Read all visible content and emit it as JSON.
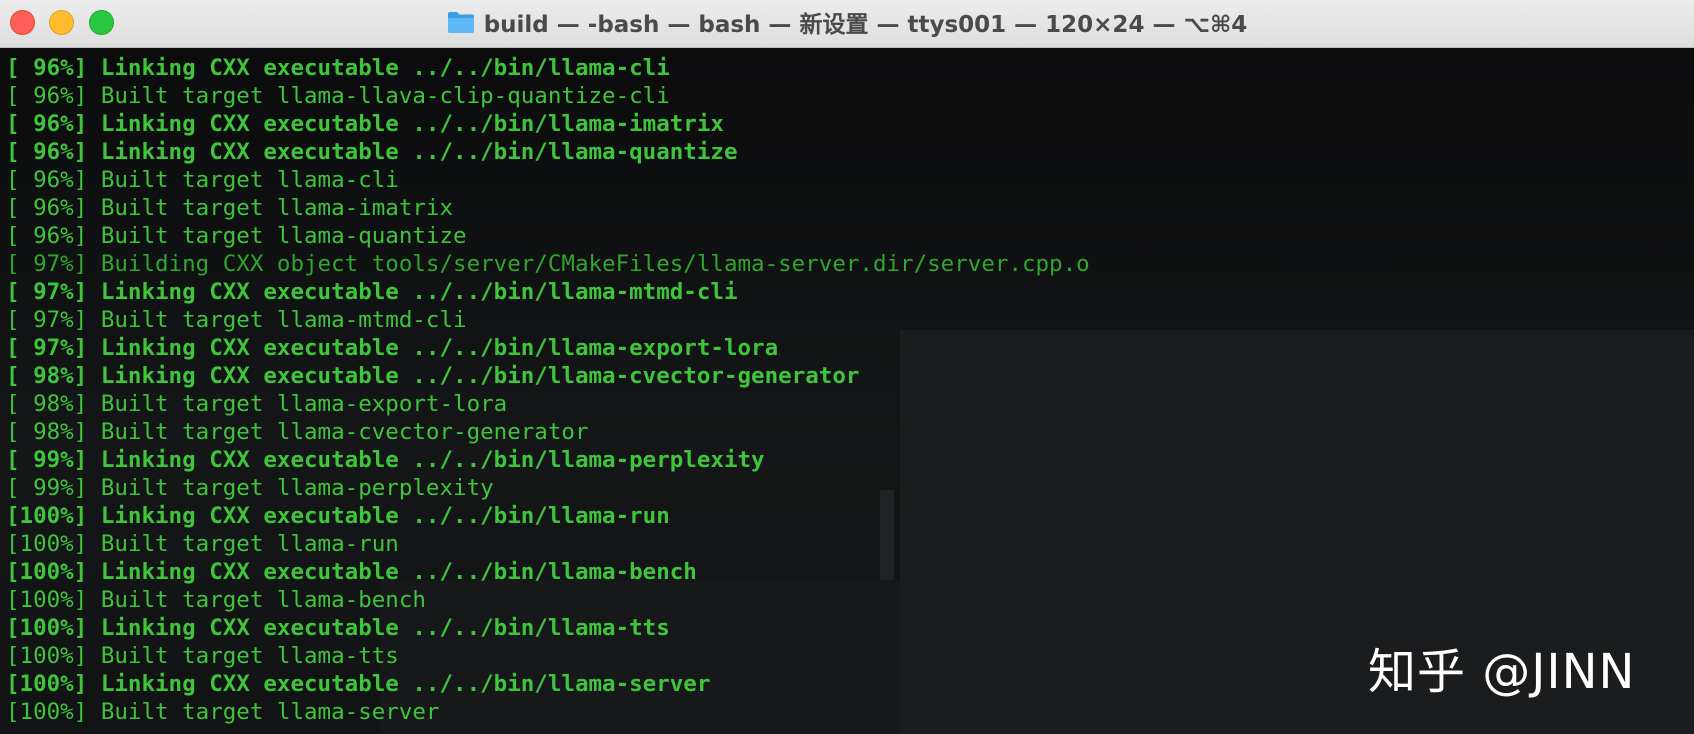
{
  "window": {
    "title": "build — -bash — bash — 新设置 — ttys001 — 120×24 — ⌥⌘4"
  },
  "terminal": {
    "lines": [
      {
        "text": "[ 96%] Linking CXX executable ../../bin/llama-cli",
        "style": "bold"
      },
      {
        "text": "[ 96%] Built target llama-llava-clip-quantize-cli",
        "style": "normal"
      },
      {
        "text": "[ 96%] Linking CXX executable ../../bin/llama-imatrix",
        "style": "bold"
      },
      {
        "text": "[ 96%] Linking CXX executable ../../bin/llama-quantize",
        "style": "bold"
      },
      {
        "text": "[ 96%] Built target llama-cli",
        "style": "normal"
      },
      {
        "text": "[ 96%] Built target llama-imatrix",
        "style": "normal"
      },
      {
        "text": "[ 96%] Built target llama-quantize",
        "style": "normal"
      },
      {
        "text": "[ 97%] Building CXX object tools/server/CMakeFiles/llama-server.dir/server.cpp.o",
        "style": "dim"
      },
      {
        "text": "[ 97%] Linking CXX executable ../../bin/llama-mtmd-cli",
        "style": "bold"
      },
      {
        "text": "[ 97%] Built target llama-mtmd-cli",
        "style": "normal"
      },
      {
        "text": "[ 97%] Linking CXX executable ../../bin/llama-export-lora",
        "style": "bold"
      },
      {
        "text": "[ 98%] Linking CXX executable ../../bin/llama-cvector-generator",
        "style": "bold"
      },
      {
        "text": "[ 98%] Built target llama-export-lora",
        "style": "normal"
      },
      {
        "text": "[ 98%] Built target llama-cvector-generator",
        "style": "normal"
      },
      {
        "text": "[ 99%] Linking CXX executable ../../bin/llama-perplexity",
        "style": "bold"
      },
      {
        "text": "[ 99%] Built target llama-perplexity",
        "style": "normal"
      },
      {
        "text": "[100%] Linking CXX executable ../../bin/llama-run",
        "style": "bold"
      },
      {
        "text": "[100%] Built target llama-run",
        "style": "normal"
      },
      {
        "text": "[100%] Linking CXX executable ../../bin/llama-bench",
        "style": "bold"
      },
      {
        "text": "[100%] Built target llama-bench",
        "style": "normal"
      },
      {
        "text": "[100%] Linking CXX executable ../../bin/llama-tts",
        "style": "bold"
      },
      {
        "text": "[100%] Built target llama-tts",
        "style": "normal"
      },
      {
        "text": "[100%] Linking CXX executable ../../bin/llama-server",
        "style": "bold"
      },
      {
        "text": "[100%] Built target llama-server",
        "style": "normal"
      }
    ]
  },
  "watermark": {
    "text": "知乎 @JINN"
  },
  "colors": {
    "terminal_text": "#3fc43c",
    "terminal_bg": "#0e0f10",
    "close": "#fe5f57",
    "minimize": "#febc2e",
    "maximize": "#28c840"
  },
  "icons": {
    "title": "folder-icon"
  }
}
